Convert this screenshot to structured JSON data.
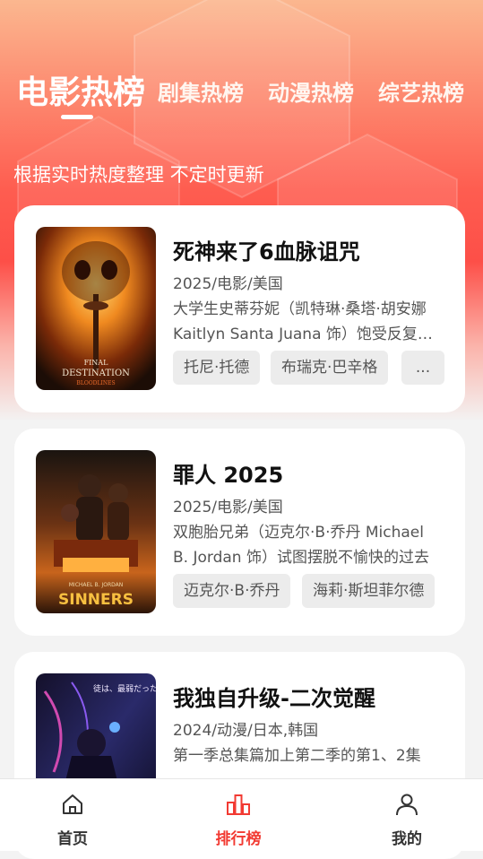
{
  "tabs": [
    {
      "label": "电影热榜",
      "active": true
    },
    {
      "label": "剧集热榜",
      "active": false
    },
    {
      "label": "动漫热榜",
      "active": false
    },
    {
      "label": "综艺热榜",
      "active": false
    }
  ],
  "subtitle": "根据实时热度整理 不定时更新",
  "cards": [
    {
      "title": "死神来了6血脉诅咒",
      "meta": "2025/电影/美国",
      "desc": "大学生史蒂芬妮（凯特琳·桑塔·胡安娜 Kaitlyn Santa Juana 饰）饱受反复噩梦的困扰",
      "tags": [
        "托尼·托德",
        "布瑞克·巴辛格",
        "..."
      ],
      "poster_text": [
        "FINAL",
        "DESTINATION",
        "BLOODLINES"
      ]
    },
    {
      "title": "罪人 2025",
      "meta": "2025/电影/美国",
      "desc": "双胞胎兄弟（迈克尔·B·乔丹 Michael B. Jordan 饰）试图摆脱不愉快的过去",
      "tags": [
        "迈克尔·B·乔丹",
        "海莉·斯坦菲尔德"
      ],
      "poster_text": [
        "MICHAEL B. JORDAN",
        "SINNERS"
      ]
    },
    {
      "title": "我独自升级-二次觉醒",
      "meta": "2024/动漫/日本,韩国",
      "desc": "第一季总集篇加上第二季的第1、2集",
      "tags": [],
      "poster_text": [
        "徒は、最弱だった"
      ]
    }
  ],
  "nav": [
    {
      "label": "首页",
      "icon": "home-icon",
      "active": false
    },
    {
      "label": "排行榜",
      "icon": "ranking-chart-icon",
      "active": true
    },
    {
      "label": "我的",
      "icon": "user-icon",
      "active": false
    }
  ],
  "colors": {
    "accent": "#f23a32",
    "hero_top": "#fbb78f",
    "hero_mid": "#fd4f48"
  }
}
